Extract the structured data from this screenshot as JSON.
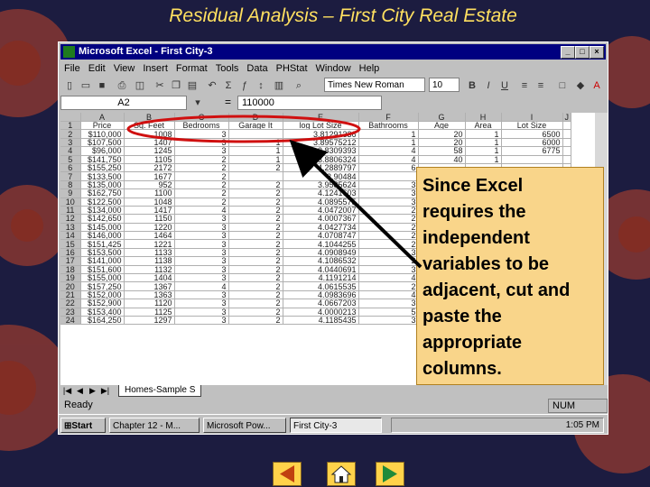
{
  "slide": {
    "title": "Residual Analysis – First City Real Estate",
    "callout": "Since Excel requires the independent variables to be adjacent, cut and paste the appropriate columns."
  },
  "excel": {
    "title": "Microsoft Excel - First City-3",
    "menu": [
      "File",
      "Edit",
      "View",
      "Insert",
      "Format",
      "Tools",
      "Data",
      "PHStat",
      "Window",
      "Help"
    ],
    "font_name": "Times New Roman",
    "font_size": "10",
    "name_box": "A2",
    "formula_value": "110000",
    "column_letters": [
      "A",
      "B",
      "C",
      "D",
      "E",
      "F",
      "G",
      "H",
      "I",
      "J"
    ],
    "headers": [
      "Price",
      "Sq. Feet",
      "Bedrooms",
      "Garage It",
      "log Lot Size",
      "Bathrooms",
      "Age",
      "Area",
      "Lot Size"
    ],
    "row_numbers": [
      "1",
      "2",
      "3",
      "4",
      "5",
      "6",
      "7",
      "8",
      "9",
      "10",
      "11",
      "12",
      "13",
      "14",
      "15",
      "16",
      "17",
      "18",
      "19",
      "20",
      "21",
      "22",
      "23",
      "24",
      "25"
    ],
    "rows": [
      [
        "$110,000",
        "1008",
        "3",
        "",
        "3.81291336",
        "1",
        "20",
        "1",
        "6500"
      ],
      [
        "$107,500",
        "1407",
        "3",
        "1",
        "3.89575212",
        "1",
        "20",
        "1",
        "6000"
      ],
      [
        "$96,000",
        "1245",
        "3",
        "1",
        "3.8309393",
        "4",
        "58",
        "1",
        "6775"
      ],
      [
        "$141,750",
        "1105",
        "2",
        "1",
        "3.8806324",
        "4",
        "40",
        "1",
        ""
      ],
      [
        "$155,250",
        "2172",
        "2",
        "2",
        "4.2889797",
        "6",
        "",
        "",
        ""
      ],
      [
        "$133,500",
        "1677",
        "2",
        "",
        "3.90484",
        "",
        "",
        "",
        ""
      ],
      [
        "$135,000",
        "952",
        "2",
        "2",
        "3.9585624",
        "3",
        "",
        "",
        ""
      ],
      [
        "$162,750",
        "1100",
        "2",
        "2",
        "4.1241603",
        "3",
        "",
        "",
        ""
      ],
      [
        "$122,500",
        "1048",
        "2",
        "2",
        "4.0895575",
        "3",
        "",
        "",
        ""
      ],
      [
        "$134,000",
        "1417",
        "4",
        "2",
        "4.0472007",
        "2",
        "",
        "",
        ""
      ],
      [
        "$142,650",
        "1150",
        "3",
        "2",
        "4.0007367",
        "2",
        "",
        "",
        ""
      ],
      [
        "$145,000",
        "1220",
        "3",
        "2",
        "4.0427734",
        "2",
        "",
        "",
        ""
      ],
      [
        "$146,000",
        "1464",
        "3",
        "2",
        "4.0708747",
        "2",
        "",
        "",
        ""
      ],
      [
        "$151,425",
        "1221",
        "3",
        "2",
        "4.1044255",
        "2",
        "",
        "",
        ""
      ],
      [
        "$153,500",
        "1133",
        "3",
        "2",
        "4.0908949",
        "3",
        "",
        "",
        ""
      ],
      [
        "$141,000",
        "1138",
        "3",
        "2",
        "4.1086532",
        "2",
        "",
        "",
        ""
      ],
      [
        "$151,600",
        "1132",
        "3",
        "2",
        "4.0440691",
        "3",
        "",
        "",
        ""
      ],
      [
        "$155,000",
        "1404",
        "3",
        "2",
        "4.1191214",
        "4",
        "",
        "",
        ""
      ],
      [
        "$157,250",
        "1367",
        "4",
        "2",
        "4.0615535",
        "2",
        "",
        "",
        ""
      ],
      [
        "$152,000",
        "1363",
        "3",
        "2",
        "4.0983696",
        "4",
        "",
        "",
        ""
      ],
      [
        "$152,900",
        "1120",
        "3",
        "2",
        "4.0667203",
        "3",
        "",
        "",
        ""
      ],
      [
        "$153,400",
        "1125",
        "3",
        "2",
        "4.0000213",
        "5",
        "",
        "",
        ""
      ],
      [
        "$164,250",
        "1297",
        "3",
        "2",
        "4.1185435",
        "3",
        "",
        "",
        ""
      ]
    ],
    "sheet_tab": "Homes-Sample S",
    "status": "Ready",
    "num_indicator": "NUM"
  },
  "taskbar": {
    "start": "Start",
    "buttons": [
      "Chapter 12 - M...",
      "Microsoft Pow...",
      "First City-3"
    ],
    "clock": "1:05 PM"
  },
  "colors": {
    "title": "#ffe060",
    "callout_bg": "#f9d58a",
    "highlight_ellipse": "#d01010",
    "arrow": "#000000",
    "background": "#1c1c40"
  },
  "icons": [
    "gear-icon",
    "prev-slide-icon",
    "home-icon",
    "next-slide-icon"
  ]
}
